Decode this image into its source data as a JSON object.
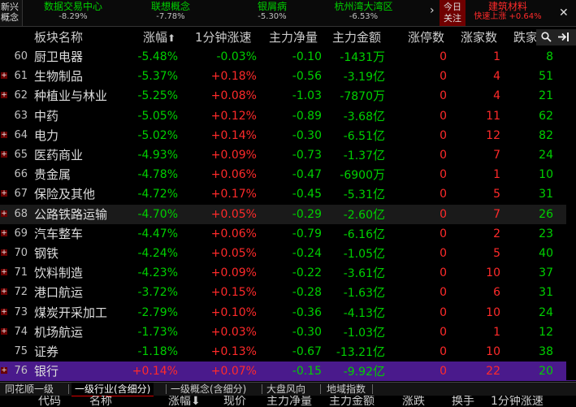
{
  "topbar": {
    "left_label": "新兴\n概念",
    "tickers": [
      {
        "name": "数据交易中心",
        "value": "-8.29%"
      },
      {
        "name": "联想概念",
        "value": "-7.78%"
      },
      {
        "name": "银屑病",
        "value": "-5.30%"
      },
      {
        "name": "杭州湾大湾区",
        "value": "-6.53%"
      }
    ],
    "arrow": "›",
    "today_label": "今日\n关注",
    "focus": {
      "name": "建筑材料",
      "value": "快速上涨 +0.64%"
    },
    "close": "✕"
  },
  "header": {
    "name": "板块名称",
    "pct": "涨幅",
    "pct_sort": "⬆",
    "m1": "1分钟涨速",
    "net": "主力净量",
    "amount": "主力金额",
    "zt": "涨停数",
    "up": "涨家数",
    "down": "跌家"
  },
  "rows": [
    {
      "idx": "60",
      "plus": false,
      "name": "厨卫电器",
      "pct": "-5.48%",
      "m1": "-0.03%",
      "net": "-0.10",
      "amt": "-1431",
      "unit": "万",
      "zt": "0",
      "up": "1",
      "down": "8"
    },
    {
      "idx": "61",
      "plus": true,
      "name": "生物制品",
      "pct": "-5.37%",
      "m1": "+0.18%",
      "net": "-0.56",
      "amt": "-3.19",
      "unit": "亿",
      "zt": "0",
      "up": "4",
      "down": "51"
    },
    {
      "idx": "62",
      "plus": true,
      "name": "种植业与林业",
      "pct": "-5.25%",
      "m1": "+0.08%",
      "net": "-1.03",
      "amt": "-7870",
      "unit": "万",
      "zt": "0",
      "up": "4",
      "down": "21"
    },
    {
      "idx": "63",
      "plus": false,
      "name": "中药",
      "pct": "-5.05%",
      "m1": "+0.12%",
      "net": "-0.89",
      "amt": "-3.68",
      "unit": "亿",
      "zt": "0",
      "up": "11",
      "down": "62"
    },
    {
      "idx": "64",
      "plus": true,
      "name": "电力",
      "pct": "-5.02%",
      "m1": "+0.14%",
      "net": "-0.30",
      "amt": "-6.51",
      "unit": "亿",
      "zt": "0",
      "up": "12",
      "down": "82"
    },
    {
      "idx": "65",
      "plus": true,
      "name": "医药商业",
      "pct": "-4.93%",
      "m1": "+0.09%",
      "net": "-0.73",
      "amt": "-1.37",
      "unit": "亿",
      "zt": "0",
      "up": "7",
      "down": "24"
    },
    {
      "idx": "66",
      "plus": false,
      "name": "贵金属",
      "pct": "-4.78%",
      "m1": "+0.06%",
      "net": "-0.47",
      "amt": "-6900",
      "unit": "万",
      "zt": "0",
      "up": "1",
      "down": "10"
    },
    {
      "idx": "67",
      "plus": true,
      "name": "保险及其他",
      "pct": "-4.72%",
      "m1": "+0.17%",
      "net": "-0.45",
      "amt": "-5.31",
      "unit": "亿",
      "zt": "0",
      "up": "5",
      "down": "31"
    },
    {
      "idx": "68",
      "plus": true,
      "name": "公路铁路运输",
      "pct": "-4.70%",
      "m1": "+0.05%",
      "net": "-0.29",
      "amt": "-2.60",
      "unit": "亿",
      "zt": "0",
      "up": "7",
      "down": "26"
    },
    {
      "idx": "69",
      "plus": true,
      "name": "汽车整车",
      "pct": "-4.47%",
      "m1": "+0.06%",
      "net": "-0.79",
      "amt": "-6.16",
      "unit": "亿",
      "zt": "0",
      "up": "2",
      "down": "23"
    },
    {
      "idx": "70",
      "plus": true,
      "name": "钢铁",
      "pct": "-4.24%",
      "m1": "+0.05%",
      "net": "-0.24",
      "amt": "-1.05",
      "unit": "亿",
      "zt": "0",
      "up": "5",
      "down": "40"
    },
    {
      "idx": "71",
      "plus": true,
      "name": "饮料制造",
      "pct": "-4.23%",
      "m1": "+0.09%",
      "net": "-0.22",
      "amt": "-3.61",
      "unit": "亿",
      "zt": "0",
      "up": "10",
      "down": "37"
    },
    {
      "idx": "72",
      "plus": true,
      "name": "港口航运",
      "pct": "-3.72%",
      "m1": "+0.15%",
      "net": "-0.28",
      "amt": "-1.63",
      "unit": "亿",
      "zt": "0",
      "up": "6",
      "down": "31"
    },
    {
      "idx": "73",
      "plus": true,
      "name": "煤炭开采加工",
      "pct": "-2.79%",
      "m1": "+0.10%",
      "net": "-0.36",
      "amt": "-4.13",
      "unit": "亿",
      "zt": "0",
      "up": "10",
      "down": "24"
    },
    {
      "idx": "74",
      "plus": true,
      "name": "机场航运",
      "pct": "-1.73%",
      "m1": "+0.03%",
      "net": "-0.30",
      "amt": "-1.03",
      "unit": "亿",
      "zt": "0",
      "up": "1",
      "down": "12"
    },
    {
      "idx": "75",
      "plus": false,
      "name": "证券",
      "pct": "-1.18%",
      "m1": "+0.13%",
      "net": "-0.67",
      "amt": "-13.21",
      "unit": "亿",
      "zt": "0",
      "up": "10",
      "down": "38"
    },
    {
      "idx": "76",
      "plus": true,
      "name": "银行",
      "pct": "+0.14%",
      "m1": "+0.07%",
      "net": "-0.15",
      "amt": "-9.92",
      "unit": "亿",
      "zt": "0",
      "up": "22",
      "down": "20"
    }
  ],
  "highlight_idx": "68",
  "selected_idx": "76",
  "tabs": [
    "同花顺一级",
    "一级行业(含细分)",
    "一级概念(含细分)",
    "大盘风向",
    "地域指数"
  ],
  "active_tab": 1,
  "footer": [
    "代码",
    "名称",
    "涨幅⬇",
    "现价",
    "主力净量",
    "主力金额",
    "涨跌",
    "换手",
    "1分钟涨速"
  ],
  "icons": {
    "search": "🔍",
    "exit": "⇥"
  },
  "colors": {
    "up": "#ff2a2a",
    "down": "#00d000",
    "selected": "#4a1a8c"
  }
}
